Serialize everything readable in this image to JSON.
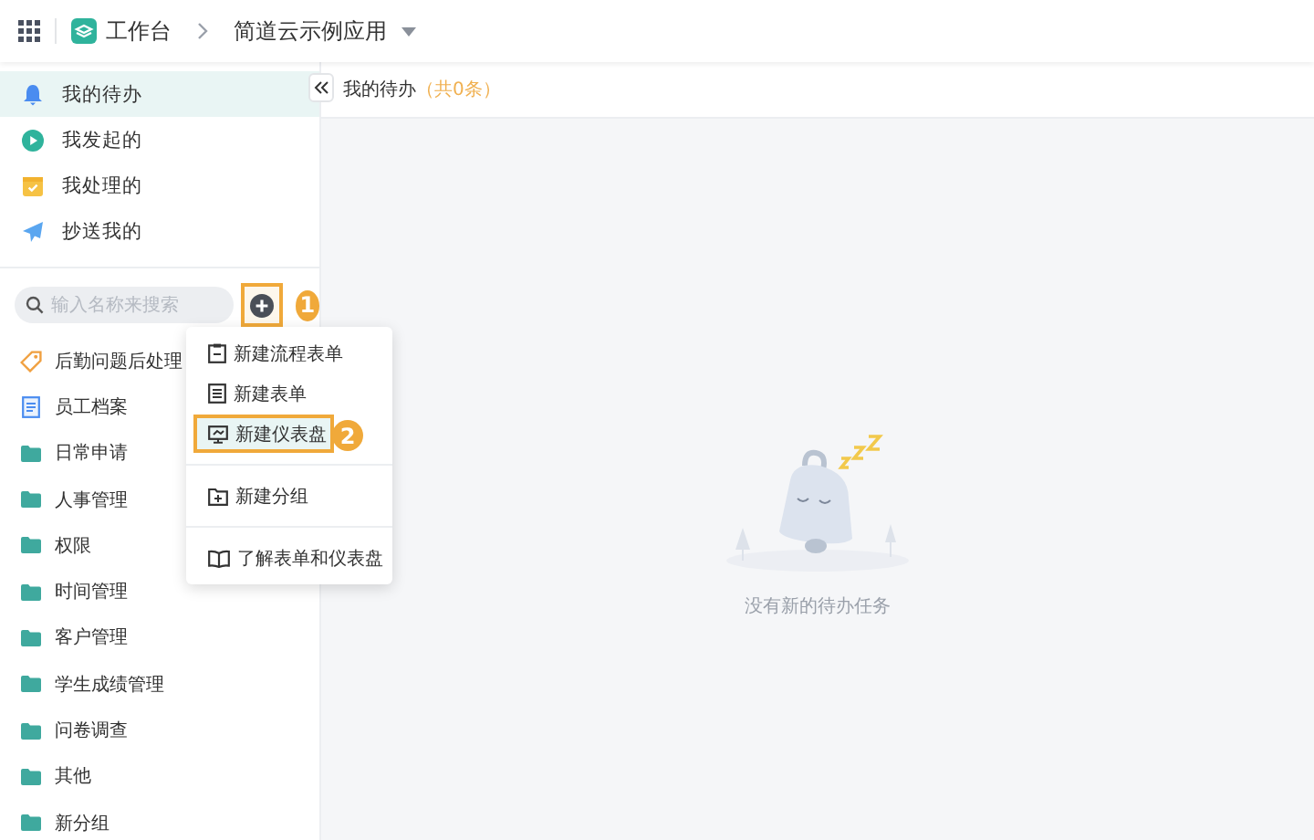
{
  "topbar": {
    "workspace": "工作台",
    "app_name": "简道云示例应用"
  },
  "nav": [
    {
      "kind": "bell",
      "label": "我的待办",
      "selected": true
    },
    {
      "kind": "play",
      "label": "我发起的",
      "selected": false
    },
    {
      "kind": "inbox",
      "label": "我处理的",
      "selected": false
    },
    {
      "kind": "send",
      "label": "抄送我的",
      "selected": false
    }
  ],
  "search": {
    "placeholder": "输入名称来搜索"
  },
  "add_button": {
    "annotated": true,
    "step": "1"
  },
  "tree": [
    {
      "kind": "tag",
      "label": "后勤问题后处理"
    },
    {
      "kind": "doc",
      "label": "员工档案"
    },
    {
      "kind": "folder",
      "label": "日常申请"
    },
    {
      "kind": "folder",
      "label": "人事管理"
    },
    {
      "kind": "folder",
      "label": "权限"
    },
    {
      "kind": "folder",
      "label": "时间管理"
    },
    {
      "kind": "folder",
      "label": "客户管理"
    },
    {
      "kind": "folder",
      "label": "学生成绩管理"
    },
    {
      "kind": "folder",
      "label": "问卷调查"
    },
    {
      "kind": "folder",
      "label": "其他"
    },
    {
      "kind": "folder",
      "label": "新分组"
    }
  ],
  "menu": [
    {
      "kind": "flow-form",
      "label": "新建流程表单",
      "divider_before": false,
      "hovered": false,
      "annotated": false
    },
    {
      "kind": "form",
      "label": "新建表单",
      "divider_before": false,
      "hovered": false,
      "annotated": false
    },
    {
      "kind": "dashboard",
      "label": "新建仪表盘",
      "divider_before": false,
      "hovered": true,
      "annotated": true,
      "step": "2"
    },
    {
      "kind": "group",
      "label": "新建分组",
      "divider_before": true,
      "hovered": false,
      "annotated": false
    },
    {
      "kind": "book",
      "label": "了解表单和仪表盘",
      "divider_before": true,
      "hovered": false,
      "annotated": false
    }
  ],
  "main": {
    "title": "我的待办",
    "count": "（共0条）",
    "empty_text": "没有新的待办任务"
  }
}
